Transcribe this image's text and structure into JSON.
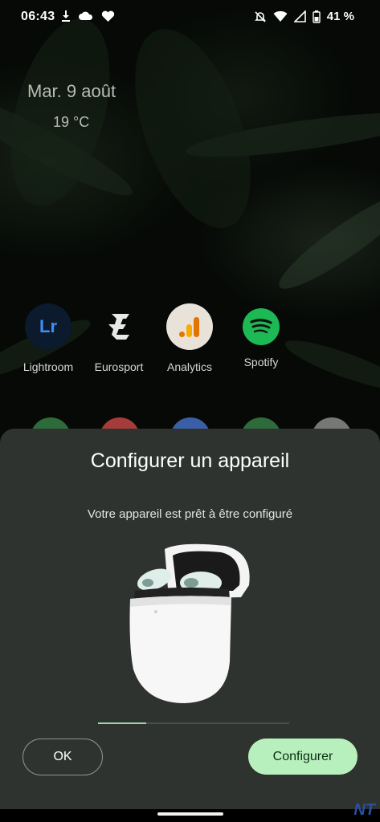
{
  "status_bar": {
    "time": "06:43",
    "battery_percent": "41 %",
    "left_icons": [
      "download-icon",
      "cloud-icon",
      "heart-icon"
    ],
    "right_icons": [
      "bell-off-icon",
      "wifi-icon",
      "signal-icon",
      "battery-icon"
    ]
  },
  "widget": {
    "date": "Mar. 9 août",
    "temperature": "19 °C",
    "weather_icon": "moon-icon"
  },
  "apps": [
    {
      "label": "Lightroom",
      "icon": "lightroom-icon"
    },
    {
      "label": "Eurosport",
      "icon": "eurosport-icon"
    },
    {
      "label": "Analytics",
      "icon": "analytics-icon"
    },
    {
      "label": "Spotify",
      "icon": "spotify-icon"
    }
  ],
  "sheet": {
    "title": "Configurer un appareil",
    "subtitle": "Votre appareil est prêt à être configuré",
    "product_image": "earbuds-case-image",
    "progress": 0.25,
    "ok_label": "OK",
    "configure_label": "Configurer"
  },
  "watermark": "NT",
  "colors": {
    "sheet_bg": "#2f332f",
    "accent_button": "#b7f0bd",
    "progress_fill": "#9fd6a8"
  }
}
